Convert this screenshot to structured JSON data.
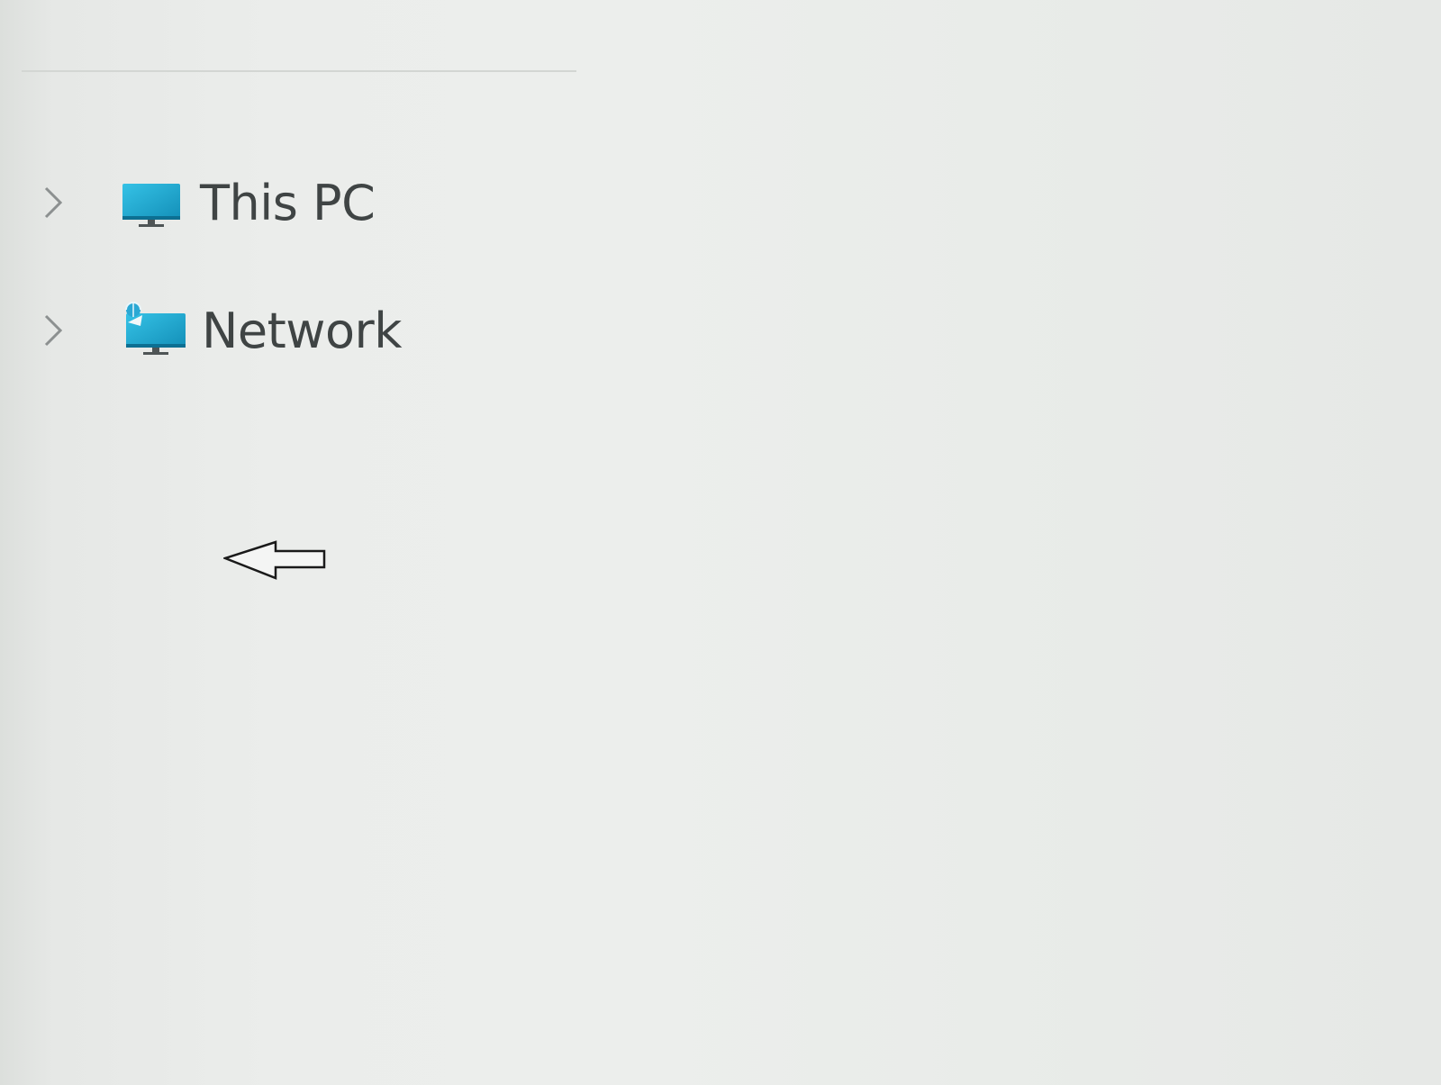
{
  "nav": {
    "items": [
      {
        "label": "This PC",
        "icon": "monitor-icon",
        "expander": "chevron-right-icon"
      },
      {
        "label": "Network",
        "icon": "network-icon",
        "expander": "chevron-right-icon"
      }
    ]
  },
  "colors": {
    "icon_accent": "#1fa6c9",
    "label_text": "#3f4444",
    "chevron": "#8c9090"
  },
  "cursor": {
    "icon": "left-arrow-icon"
  }
}
